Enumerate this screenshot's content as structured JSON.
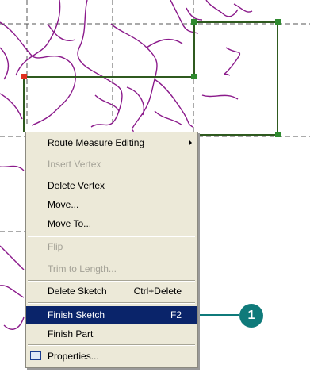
{
  "context_menu": {
    "items": [
      {
        "label": "Route Measure Editing",
        "shortcut": "",
        "state": "normal",
        "submenu": true
      },
      {
        "label": "Insert Vertex",
        "shortcut": "",
        "state": "disabled"
      },
      {
        "label": "Delete Vertex",
        "shortcut": "",
        "state": "normal"
      },
      {
        "label": "Move...",
        "shortcut": "",
        "state": "normal"
      },
      {
        "label": "Move To...",
        "shortcut": "",
        "state": "normal"
      },
      {
        "label": "Flip",
        "shortcut": "",
        "state": "disabled"
      },
      {
        "label": "Trim to Length...",
        "shortcut": "",
        "state": "disabled"
      },
      {
        "label": "Delete Sketch",
        "shortcut": "Ctrl+Delete",
        "state": "normal"
      },
      {
        "label": "Finish Sketch",
        "shortcut": "F2",
        "state": "selected"
      },
      {
        "label": "Finish Part",
        "shortcut": "",
        "state": "normal"
      },
      {
        "label": "Properties...",
        "shortcut": "",
        "state": "normal",
        "icon": "properties-icon"
      }
    ]
  },
  "callout": {
    "number": "1"
  },
  "colors": {
    "selection_bg": "#0a246a",
    "menu_bg": "#ece9d8",
    "road_lines": "#8b1a8b",
    "sketch_lines": "#2f5a1f",
    "vertex": "#2f8a2f",
    "first_vertex": "#e03020",
    "callout_fill": "#0f7a7a"
  }
}
